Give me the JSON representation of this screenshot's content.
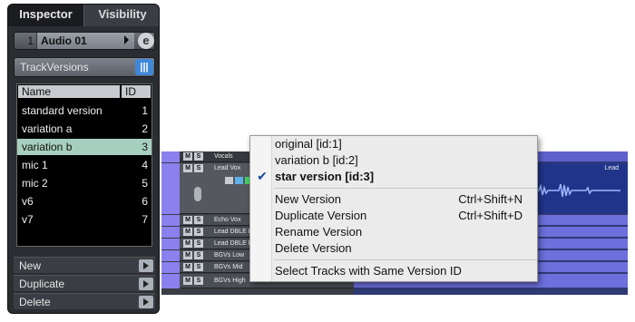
{
  "inspector": {
    "tabs": [
      {
        "label": "Inspector"
      },
      {
        "label": "Visibility"
      }
    ],
    "track": {
      "number": "1",
      "name": "Audio 01"
    },
    "edit_icon_glyph": "e",
    "track_versions": {
      "label": "TrackVersions",
      "icon_glyph": "|||"
    },
    "table": {
      "headers": {
        "name": "Name",
        "id": "ID"
      },
      "rows": [
        {
          "name": "standard version",
          "id": "1"
        },
        {
          "name": "variation a",
          "id": "2"
        },
        {
          "name": "variation b",
          "id": "3"
        },
        {
          "name": "mic 1",
          "id": "4"
        },
        {
          "name": "mic 2",
          "id": "5"
        },
        {
          "name": "v6",
          "id": "6"
        },
        {
          "name": "v7",
          "id": "7"
        }
      ],
      "selected_index": 2
    },
    "actions": [
      {
        "label": "New"
      },
      {
        "label": "Duplicate"
      },
      {
        "label": "Delete"
      }
    ]
  },
  "tracks": {
    "mute": "M",
    "solo": "S",
    "rows": [
      {
        "name": "Vocals"
      },
      {
        "name": "Lead Vox"
      },
      {
        "name": "Echo Vox"
      },
      {
        "name": "Lead DBLE L"
      },
      {
        "name": "Lead DBLE R"
      },
      {
        "name": "BGVs Low"
      },
      {
        "name": "BGVs Mid"
      },
      {
        "name": "BGVs High"
      }
    ]
  },
  "arrange": {
    "lead_label": "Lead"
  },
  "context_menu": {
    "versions": [
      {
        "label": "original [id:1]",
        "checked": false
      },
      {
        "label": "variation b [id:2]",
        "checked": false
      },
      {
        "label": "star version [id:3]",
        "checked": true
      }
    ],
    "check_glyph": "✔",
    "commands": [
      {
        "label": "New Version",
        "shortcut": "Ctrl+Shift+N"
      },
      {
        "label": "Duplicate Version",
        "shortcut": "Ctrl+Shift+D"
      },
      {
        "label": "Rename Version",
        "shortcut": ""
      },
      {
        "label": "Delete Version",
        "shortcut": ""
      }
    ],
    "footer": "Select Tracks with Same Version ID"
  },
  "colors": {
    "selected_row": "#a6cfbf",
    "track_versions_icon": "#3f87d8",
    "folder_tab": "#8a80ee",
    "arrange_bg": "#2f3a74"
  }
}
